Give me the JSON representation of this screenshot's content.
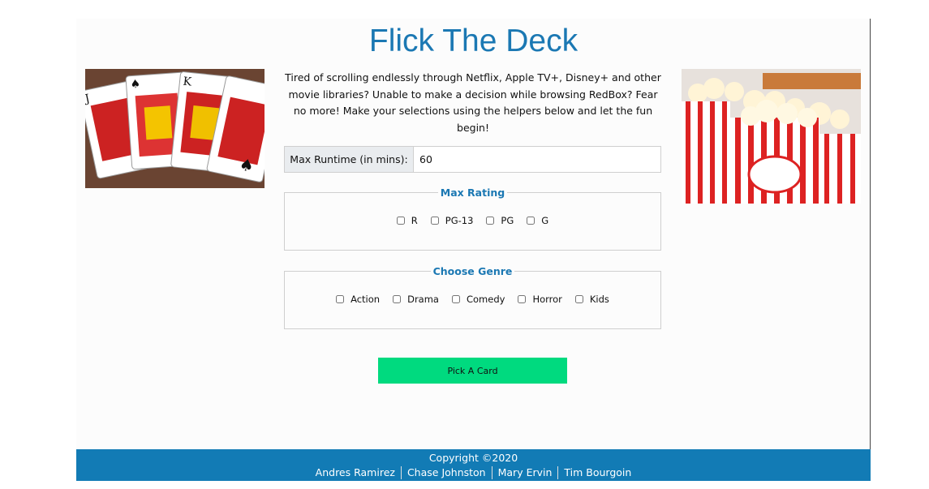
{
  "header": {
    "title": "Flick The Deck"
  },
  "intro": {
    "text": "Tired of scrolling endlessly through Netflix, Apple TV+, Disney+ and other movie libraries? Unable to make a decision while browsing RedBox? Fear no more! Make your selections using the helpers below and let the fun begin!"
  },
  "runtime": {
    "label": "Max Runtime (in mins):",
    "value": "60"
  },
  "rating": {
    "legend": "Max Rating",
    "options": [
      "R",
      "PG-13",
      "PG",
      "G"
    ]
  },
  "genre": {
    "legend": "Choose Genre",
    "options": [
      "Action",
      "Drama",
      "Comedy",
      "Horror",
      "Kids"
    ]
  },
  "button": {
    "label": "Pick A Card"
  },
  "footer": {
    "copyright": "Copyright ©2020",
    "names": [
      "Andres Ramirez",
      "Chase Johnston",
      "Mary Ervin",
      "Tim Bourgoin"
    ]
  },
  "colors": {
    "title": "#1b78b3",
    "accent_button": "#00da7f",
    "footer": "#127bb5"
  },
  "images": {
    "left": "playing-cards-photo",
    "right": "popcorn-photo"
  }
}
